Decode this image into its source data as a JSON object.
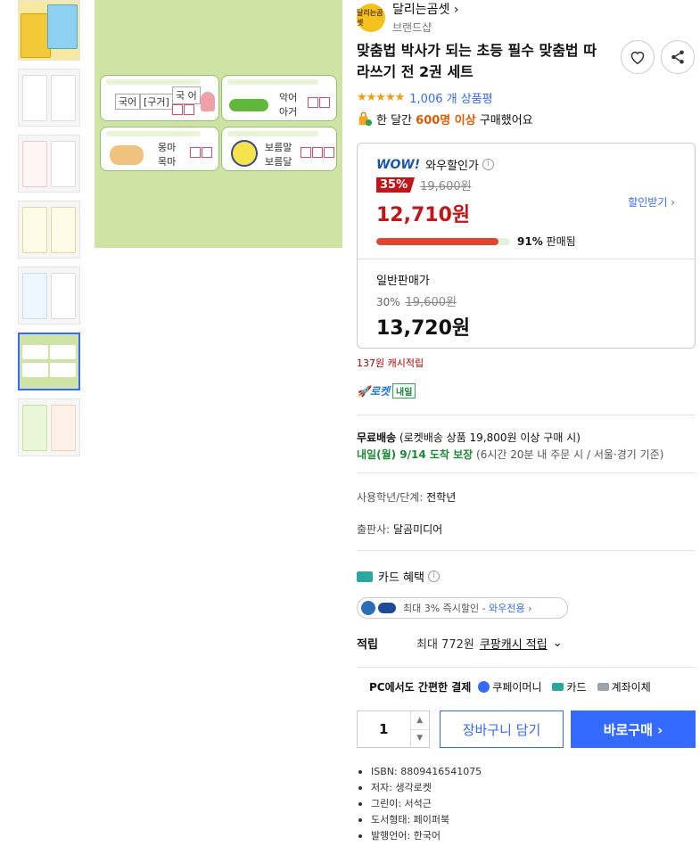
{
  "thumbnails": [
    {
      "label": "book-cover"
    },
    {
      "label": "page-1"
    },
    {
      "label": "page-2"
    },
    {
      "label": "page-3"
    },
    {
      "label": "page-4"
    },
    {
      "label": "page-5",
      "selected": true
    },
    {
      "label": "page-6"
    }
  ],
  "main_image": {
    "panel1": {
      "word1": "국어",
      "word2": "[구거]",
      "word3": "국 어"
    },
    "panel2": {
      "word1": "악어",
      "word2": "아거"
    },
    "panel3": {
      "word1": "몽마",
      "word2": "목마"
    },
    "panel4": {
      "word1": "보름말",
      "word2": "보름달"
    }
  },
  "brand": {
    "logo_text": "달리는곰셋",
    "name": "달리는곰셋",
    "sub": "브랜드샵"
  },
  "product": {
    "title": "맞춤법 박사가 되는 초등 필수 맞춤법 따라쓰기 전 2권 세트",
    "stars": "★★★★★",
    "reviews": "1,006 개 상품평",
    "buyers_pre": "한 달간",
    "buyers_hl": "600명 이상",
    "buyers_post": "구매했어요"
  },
  "price": {
    "wow_logo": "WOW!",
    "wow_label": "와우할인가",
    "discount": "35%",
    "original": "19,600원",
    "wow_price": "12,710원",
    "coupon": "할인받기 ›",
    "sold_percent": 91,
    "sold_label": "91%",
    "sold_suffix": "판매됨",
    "normal_label": "일반판매가",
    "normal_disc": "30%",
    "normal_original": "19,600원",
    "normal_price": "13,720원"
  },
  "cash_reward": "137원 캐시적립",
  "rocket": {
    "label": "로켓",
    "badge": "내일"
  },
  "shipping": {
    "free_label": "무료배송",
    "free_cond": "(로켓배송 상품 19,800원 이상 구매 시)",
    "arrival": "내일(월) 9/14 도착 보장",
    "cutoff": "(6시간 20분 내 주문 시 / 서울⋅경기 기준)"
  },
  "meta": {
    "grade_label": "사용학년/단계:",
    "grade_val": "전학년",
    "publisher_label": "출판사:",
    "publisher_val": "달곰미디어"
  },
  "card": {
    "title": "카드 혜택",
    "samsung_text": "최대 3% 즉시할인 -",
    "samsung_wow": "와우전용 ›"
  },
  "points": {
    "label": "적립",
    "value": "최대 772원",
    "link": "쿠팡캐시 적립"
  },
  "easy_pay": {
    "title": "PC에서도 간편한 결제",
    "coupay": "쿠페이머니",
    "card": "카드",
    "bank": "계좌이체"
  },
  "purchase": {
    "qty": "1",
    "cart": "장바구니 담기",
    "buy": "바로구매 ›"
  },
  "specs": [
    "ISBN: 8809416541075",
    "저자: 생각로켓",
    "그린이: 서석근",
    "도서형태: 페이퍼북",
    "발행언어: 한국어"
  ],
  "colors": {
    "accent": "#346aff",
    "sale": "#c21518",
    "image_bg": "#cfe3a4"
  }
}
